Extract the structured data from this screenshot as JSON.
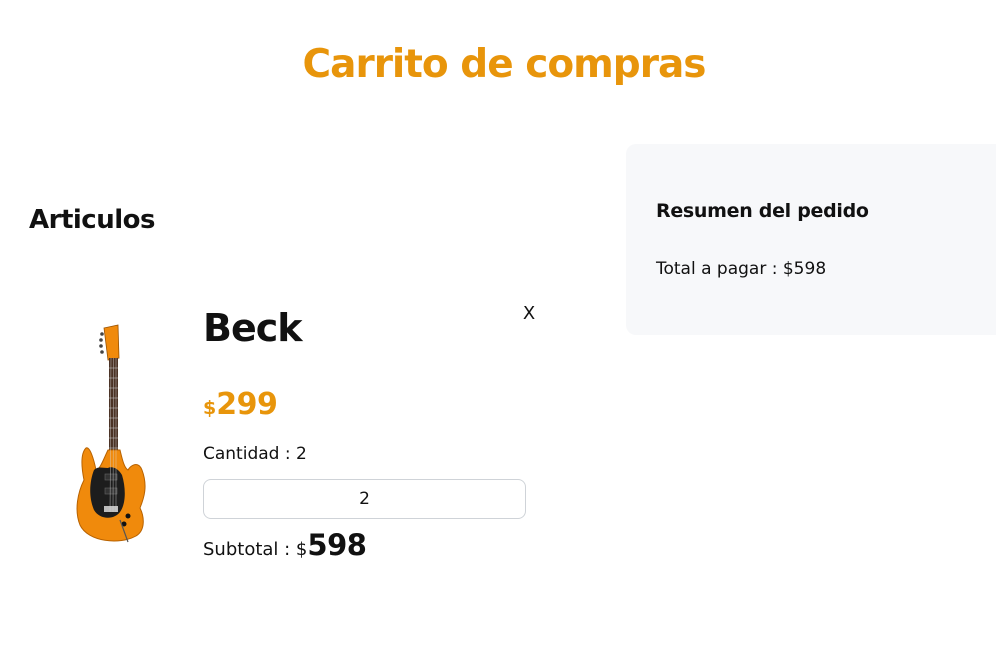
{
  "header": {
    "title": "Carrito de compras"
  },
  "items_section": {
    "title": "Articulos"
  },
  "cart_item": {
    "image_icon": "electric-guitar-orange",
    "remove_label": "X",
    "name": "Beck",
    "price_currency": "$",
    "price_amount": "299",
    "quantity_label": "Cantidad : 2",
    "quantity_value": "2",
    "subtotal_label": "Subtotal : $",
    "subtotal_amount": "598"
  },
  "summary": {
    "title": "Resumen del pedido",
    "total_label": "Total a pagar : $598"
  },
  "colors": {
    "accent": "#e8950b",
    "summary_bg": "#f7f8fa",
    "guitar_body": "#f08a0c"
  }
}
